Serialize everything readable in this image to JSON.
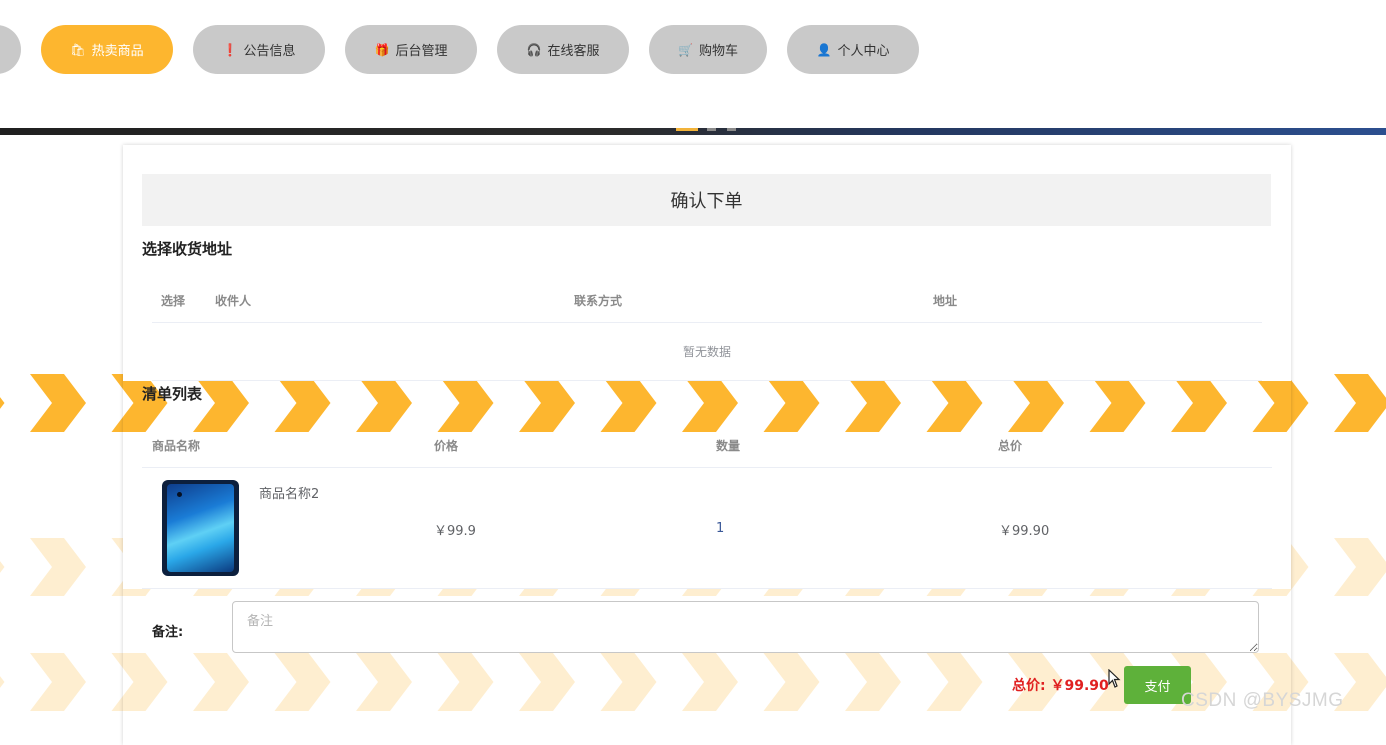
{
  "nav": {
    "items": [
      {
        "label": "",
        "icon": "partial-item"
      },
      {
        "label": "热卖商品",
        "icon": "bag-icon",
        "active": true
      },
      {
        "label": "公告信息",
        "icon": "alert-icon"
      },
      {
        "label": "后台管理",
        "icon": "gift-icon"
      },
      {
        "label": "在线客服",
        "icon": "headset-icon"
      },
      {
        "label": "购物车",
        "icon": "cart-icon"
      },
      {
        "label": "个人中心",
        "icon": "user-icon"
      }
    ]
  },
  "colors": {
    "accent": "#fdb62f",
    "inactive": "#c9c9c9",
    "pay": "#5eb13a",
    "price": "#e02020"
  },
  "page": {
    "title": "确认下单"
  },
  "address": {
    "section_title": "选择收货地址",
    "columns": [
      "选择",
      "收件人",
      "联系方式",
      "地址"
    ],
    "empty_text": "暂无数据"
  },
  "order": {
    "section_title": "清单列表",
    "columns": [
      "商品名称",
      "价格",
      "数量",
      "总价"
    ],
    "items": [
      {
        "name": "商品名称2",
        "price": "￥99.9",
        "quantity": "1",
        "subtotal": "￥99.90"
      }
    ]
  },
  "remark": {
    "label": "备注:",
    "placeholder": "备注",
    "value": ""
  },
  "footer": {
    "total": "总价: ￥99.90",
    "pay_label": "支付"
  },
  "watermark": "CSDN @BYSJMG"
}
